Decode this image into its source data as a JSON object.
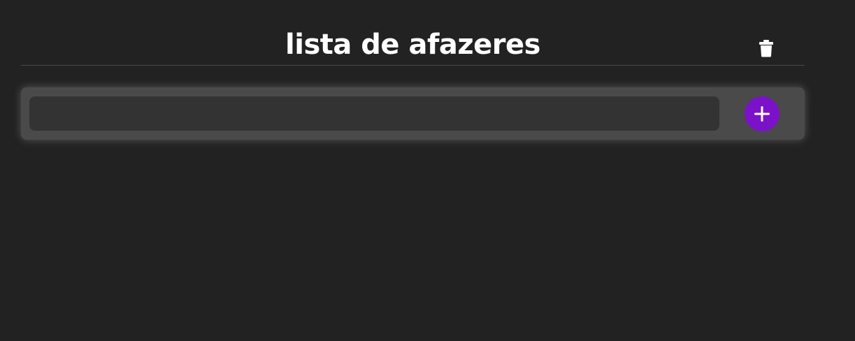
{
  "header": {
    "title": "lista de afazeres",
    "clear_icon": "trash-icon"
  },
  "form": {
    "input_value": "",
    "input_placeholder": "",
    "add_icon": "plus-icon"
  },
  "colors": {
    "background": "#222222",
    "card": "#4a4a4a",
    "input": "#333333",
    "accent": "#7b12c9",
    "text": "#ffffff"
  }
}
